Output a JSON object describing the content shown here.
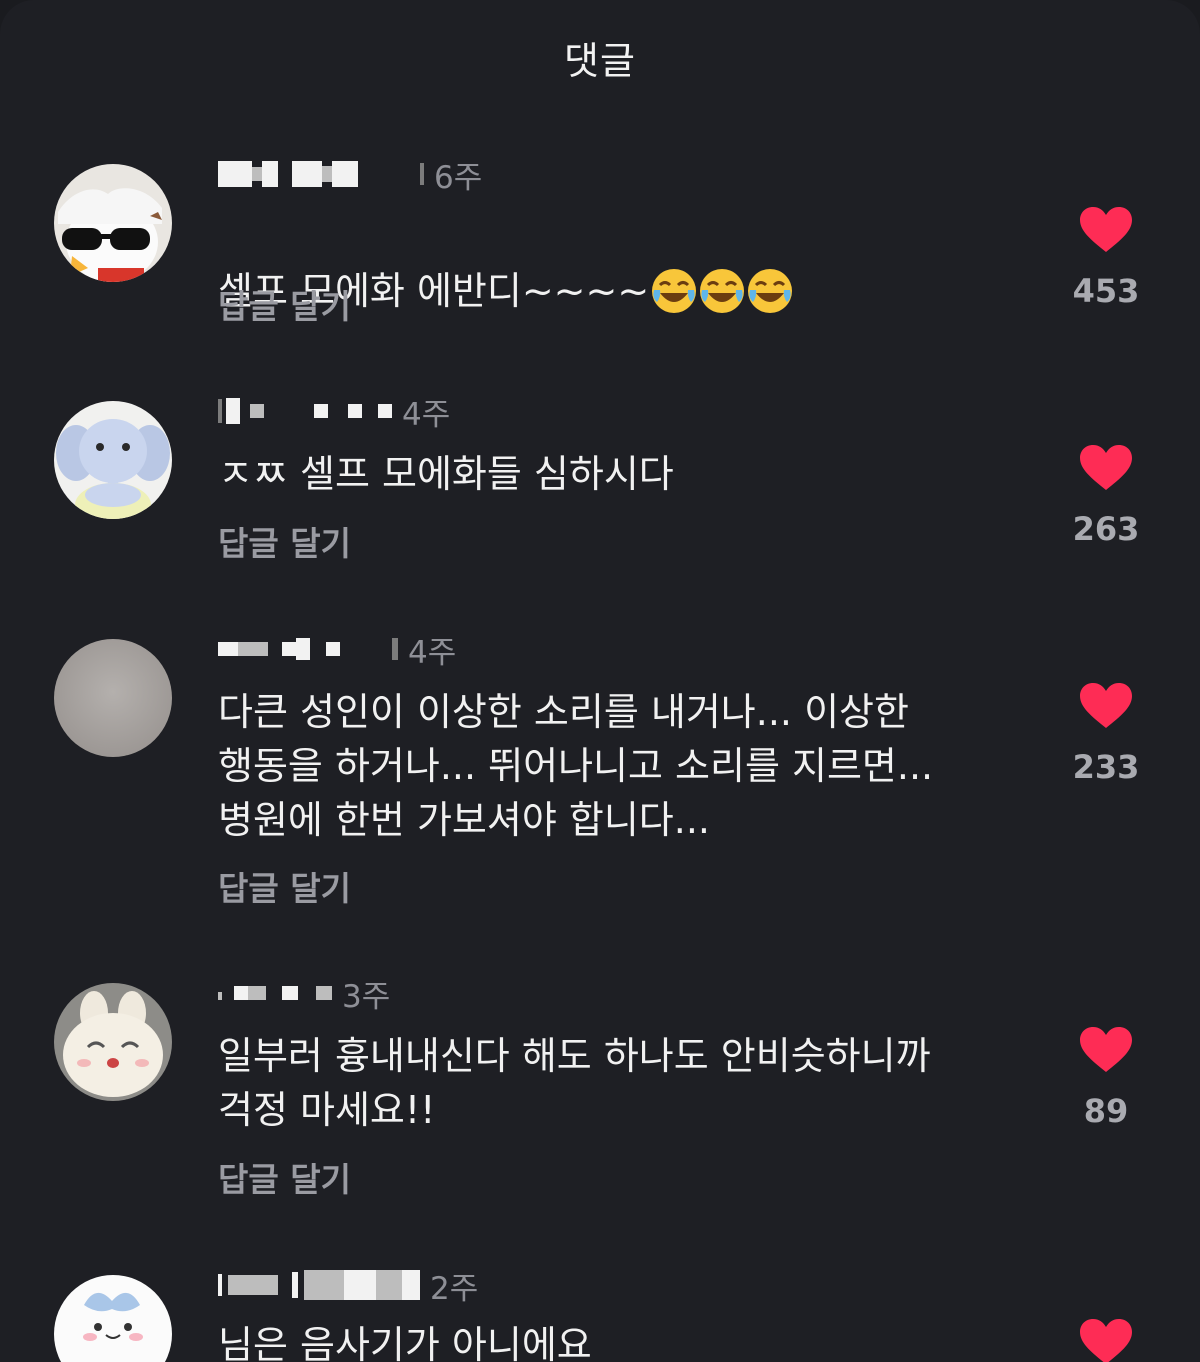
{
  "header": {
    "title": "댓글"
  },
  "comments": [
    {
      "time": "6주",
      "text": "셀프 모에화 에반디~~~~",
      "emojis": [
        "😂",
        "😂",
        "😂"
      ],
      "reply": "답글 달기",
      "likes": "453"
    },
    {
      "time": "4주",
      "text": "ㅈㅉ 셀프 모에화들 심하시다",
      "reply": "답글 달기",
      "likes": "263"
    },
    {
      "time": "4주",
      "text": "다큰 성인이 이상한 소리를 내거나... 이상한\n행동을 하거나... 뛰어나니고 소리를 지르면...\n병원에 한번 가보셔야 합니다...",
      "reply": "답글 달기",
      "likes": "233"
    },
    {
      "time": "3주",
      "text": "일부러 흉내내신다 해도 하나도 안비슷하니까\n걱정 마세요!!",
      "reply": "답글 달기",
      "likes": "89"
    },
    {
      "time": "2주",
      "text": "님은 음사기가 아니에요"
    }
  ],
  "colors": {
    "background": "#1e1f24",
    "heart": "#fe2c55"
  },
  "icons": {
    "like": "heart-icon",
    "emoji": "face-with-tears-of-joy"
  }
}
